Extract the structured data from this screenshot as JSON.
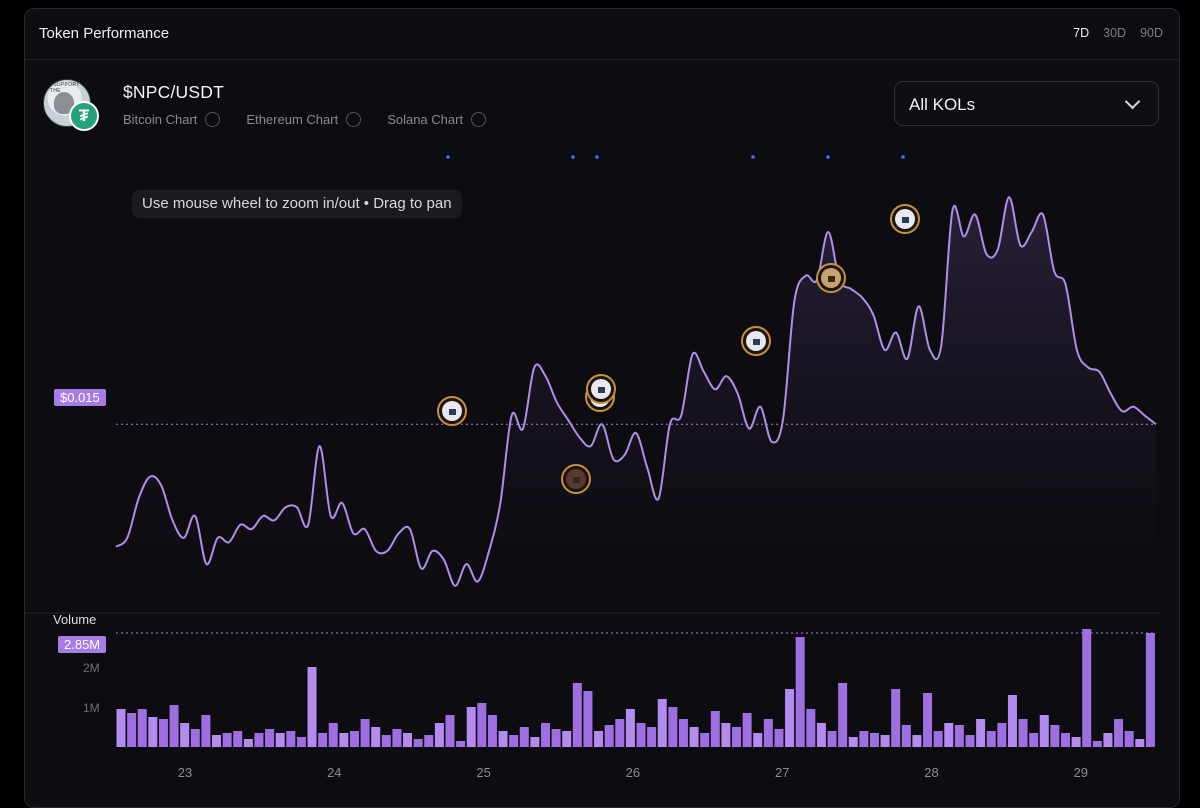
{
  "header": {
    "title": "Token Performance",
    "ranges": [
      {
        "label": "7D",
        "active": true
      },
      {
        "label": "30D",
        "active": false
      },
      {
        "label": "90D",
        "active": false
      }
    ]
  },
  "token": {
    "pair": "$NPC/USDT",
    "logo_ring_text": "I SUPPORT THE",
    "quote_icon": "tether-icon",
    "chart_toggles": [
      "Bitcoin Chart",
      "Ethereum Chart",
      "Solana Chart"
    ]
  },
  "kol_filter": {
    "selected": "All KOLs"
  },
  "hint": "Use mouse wheel to zoom in/out • Drag to pan",
  "colors": {
    "line": "#b08ee8",
    "tag": "#a77ce6",
    "volume_bar": "#9d6fe0",
    "event_dot": "#4a6dff",
    "marker_ring": "#c8923a"
  },
  "price": {
    "current_label": "$0.015",
    "current_value": 0.015
  },
  "volume": {
    "label": "Volume",
    "current_label": "2.85M",
    "ticks": [
      "2M",
      "1M"
    ]
  },
  "chart_data": {
    "type": "line",
    "x_labels": [
      "23",
      "24",
      "25",
      "26",
      "27",
      "28",
      "29"
    ],
    "price_series": [
      0.0122,
      0.0124,
      0.0133,
      0.0138,
      0.0136,
      0.0128,
      0.0124,
      0.0129,
      0.0118,
      0.0124,
      0.0123,
      0.0127,
      0.0126,
      0.0129,
      0.0128,
      0.0131,
      0.0131,
      0.0127,
      0.0145,
      0.0129,
      0.0132,
      0.0125,
      0.0126,
      0.0121,
      0.0121,
      0.0125,
      0.0126,
      0.0117,
      0.0121,
      0.0119,
      0.0113,
      0.0118,
      0.0114,
      0.0121,
      0.0132,
      0.0152,
      0.0149,
      0.0163,
      0.0161,
      0.0155,
      0.0151,
      0.0147,
      0.0145,
      0.015,
      0.0142,
      0.0143,
      0.0148,
      0.014,
      0.0133,
      0.015,
      0.0152,
      0.0166,
      0.0162,
      0.0158,
      0.0161,
      0.0157,
      0.0149,
      0.0154,
      0.0146,
      0.0151,
      0.0178,
      0.0184,
      0.0183,
      0.0194,
      0.0183,
      0.0181,
      0.0179,
      0.0175,
      0.0167,
      0.0171,
      0.0165,
      0.0177,
      0.0167,
      0.0168,
      0.0199,
      0.0193,
      0.0198,
      0.0189,
      0.019,
      0.0202,
      0.0191,
      0.0194,
      0.0198,
      0.0185,
      0.0182,
      0.0167,
      0.0163,
      0.0162,
      0.0157,
      0.0153,
      0.0154,
      0.0152,
      0.015
    ],
    "volume_series": [
      0.95,
      0.85,
      0.95,
      0.75,
      0.7,
      1.05,
      0.6,
      0.45,
      0.8,
      0.3,
      0.35,
      0.4,
      0.2,
      0.35,
      0.45,
      0.35,
      0.4,
      0.25,
      2.0,
      0.35,
      0.6,
      0.35,
      0.4,
      0.7,
      0.5,
      0.3,
      0.45,
      0.35,
      0.2,
      0.3,
      0.6,
      0.8,
      0.15,
      1.0,
      1.1,
      0.8,
      0.4,
      0.3,
      0.5,
      0.25,
      0.6,
      0.45,
      0.4,
      1.6,
      1.4,
      0.4,
      0.55,
      0.7,
      0.95,
      0.6,
      0.5,
      1.2,
      1.0,
      0.7,
      0.5,
      0.35,
      0.9,
      0.6,
      0.5,
      0.85,
      0.35,
      0.7,
      0.45,
      1.45,
      2.75,
      0.95,
      0.6,
      0.4,
      1.6,
      0.25,
      0.4,
      0.35,
      0.3,
      1.45,
      0.55,
      0.3,
      1.35,
      0.4,
      0.6,
      0.55,
      0.3,
      0.7,
      0.4,
      0.6,
      1.3,
      0.7,
      0.35,
      0.8,
      0.55,
      0.35,
      0.25,
      2.95,
      0.15,
      0.35,
      0.7,
      0.4,
      0.2,
      2.85
    ],
    "ylabel": "",
    "grid": false
  }
}
